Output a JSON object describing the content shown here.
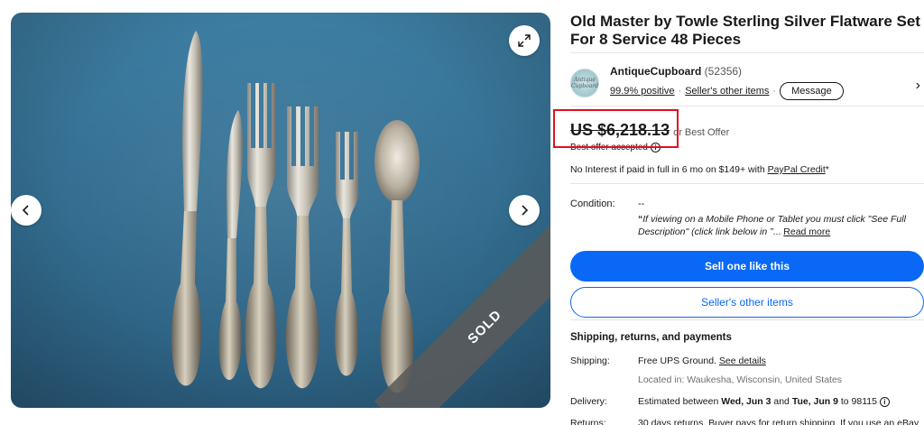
{
  "gallery": {
    "sold_label": "SOLD"
  },
  "listing": {
    "title": "Old Master by Towle Sterling Silver Flatware Set For 8 Service 48 Pieces"
  },
  "seller": {
    "avatar_text": "Antique Cupboard",
    "name": "AntiqueCupboard",
    "feedback_count": "(52356)",
    "positive": "99.9% positive",
    "other_items_link": "Seller's other items",
    "message_button": "Message"
  },
  "price": {
    "amount": "US $6,218.13",
    "or_best_offer": "or Best Offer",
    "offer_accepted": "Best offer accepted"
  },
  "financing": {
    "text": "No Interest if paid in full in 6 mo on $149+ with ",
    "link": "PayPal Credit",
    "suffix": "*"
  },
  "condition": {
    "label": "Condition:",
    "value": "--",
    "quote_open": "“",
    "description": "If viewing on a Mobile Phone or Tablet you must click \"See Full Description\" (click link below in ”",
    "ellipsis": "... ",
    "read_more": "Read more"
  },
  "actions": {
    "primary": "Sell one like this",
    "secondary": "Seller's other items"
  },
  "shipping": {
    "heading": "Shipping, returns, and payments",
    "shipping_label": "Shipping:",
    "shipping_value_bold": "Free",
    "shipping_value": " UPS Ground. ",
    "see_details": "See details",
    "location": "Located in: Waukesha, Wisconsin, United States",
    "delivery_label": "Delivery:",
    "delivery_prefix": "Estimated between ",
    "delivery_start": "Wed, Jun 3",
    "delivery_and": " and ",
    "delivery_end": "Tue, Jun 9",
    "delivery_suffix": " to 98115 ",
    "returns_label": "Returns:",
    "returns_value": "30 days returns. Buyer pays for return shipping. If you use an eBay"
  },
  "colors": {
    "primary_blue": "#0968f6",
    "highlight_red": "#e0101e",
    "photo_background": "#346f92"
  }
}
